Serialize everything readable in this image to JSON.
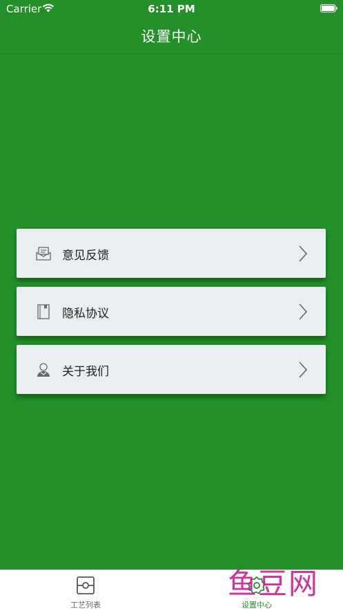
{
  "status_bar": {
    "carrier": "Carrier",
    "time": "6:11 PM"
  },
  "header": {
    "title": "设置中心"
  },
  "menu": {
    "items": [
      {
        "label": "意见反馈",
        "icon": "mail-feedback-icon"
      },
      {
        "label": "隐私协议",
        "icon": "book-icon"
      },
      {
        "label": "关于我们",
        "icon": "person-icon"
      }
    ]
  },
  "tab_bar": {
    "tabs": [
      {
        "label": "工艺列表",
        "icon": "process-list-icon",
        "active": false
      },
      {
        "label": "设置中心",
        "icon": "gear-icon",
        "active": true
      }
    ]
  },
  "watermark": {
    "text": "鱼豆网"
  },
  "colors": {
    "background": "#23902a",
    "card": "#eaeef1",
    "tab_active": "#23902a",
    "tab_inactive": "#666666",
    "watermark": "#cc1e95"
  }
}
